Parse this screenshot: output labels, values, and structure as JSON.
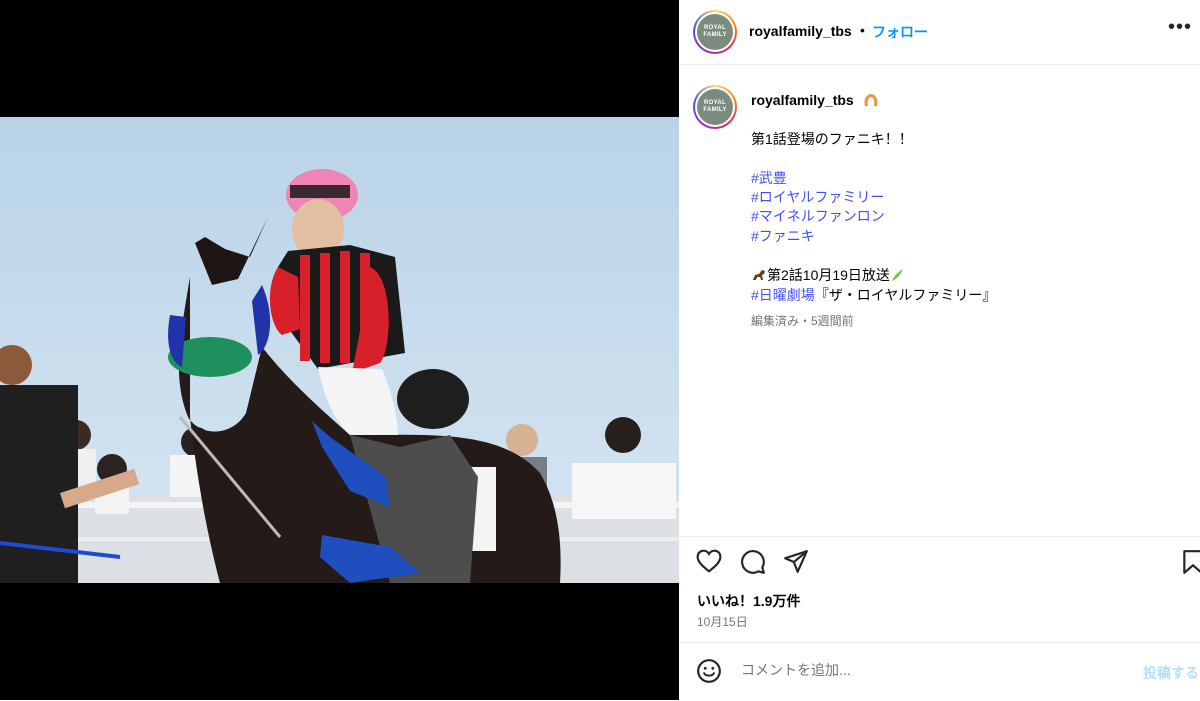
{
  "account": {
    "username": "royalfamily_tbs",
    "avatar_text": "ROYAL FAMILY",
    "follow_label": "フォロー",
    "separator": "•",
    "more_icon": "more-horizontal-icon"
  },
  "caption": {
    "username": "royalfamily_tbs",
    "emoji_after_name": "horseshoe-icon",
    "line1": "第1話登場のファニキ！！",
    "hashtags": [
      "#武豊",
      "#ロイヤルファミリー",
      "#マイネルファンロン",
      "#ファニキ"
    ],
    "broadcast_text": "第2話10月19日放送",
    "broadcast_icon_before": "horse-icon",
    "broadcast_icon_after": "herb-icon",
    "program_tag": "#日曜劇場",
    "program_title": "『ザ・ロイヤルファミリー』",
    "meta": "編集済み・5週間前"
  },
  "actions": {
    "like_icon": "heart-icon",
    "comment_icon": "comment-icon",
    "share_icon": "send-icon",
    "save_icon": "bookmark-icon"
  },
  "likes_text": "いいね！1.9万件",
  "date_text": "10月15日",
  "comment": {
    "emoji_icon": "smiley-icon",
    "placeholder": "コメントを追加...",
    "post_label": "投稿する"
  },
  "colors": {
    "accent": "#0095f6",
    "hashtag": "#4150f7",
    "muted": "#737373",
    "post_disabled": "#b2dffc"
  }
}
